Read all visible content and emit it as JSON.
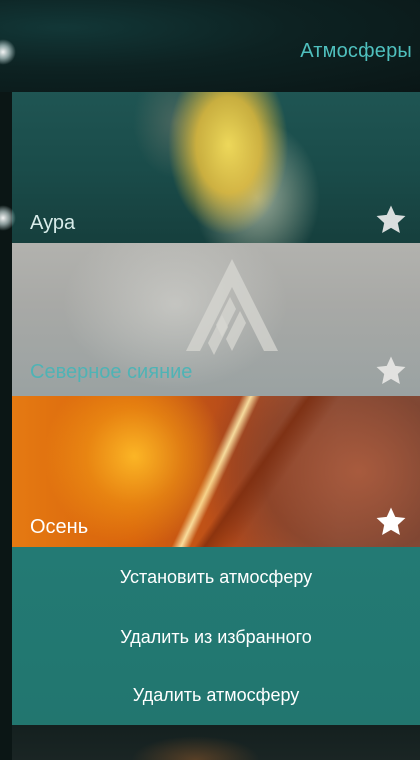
{
  "header": {
    "title": "Атмосферы"
  },
  "tiles": [
    {
      "label": "Аура",
      "favorite": true,
      "star_color": "#dfe3e3"
    },
    {
      "label": "Северное сияние",
      "favorite": true,
      "star_color": "#e6e6e6"
    },
    {
      "label": "Осень",
      "favorite": true,
      "star_color": "#ffffff"
    }
  ],
  "menu": {
    "items": [
      {
        "label": "Установить атмосферу"
      },
      {
        "label": "Удалить из избранного"
      },
      {
        "label": "Удалить атмосферу"
      }
    ]
  },
  "colors": {
    "accent": "#4fc0be",
    "menu_bg": "#237a74"
  }
}
